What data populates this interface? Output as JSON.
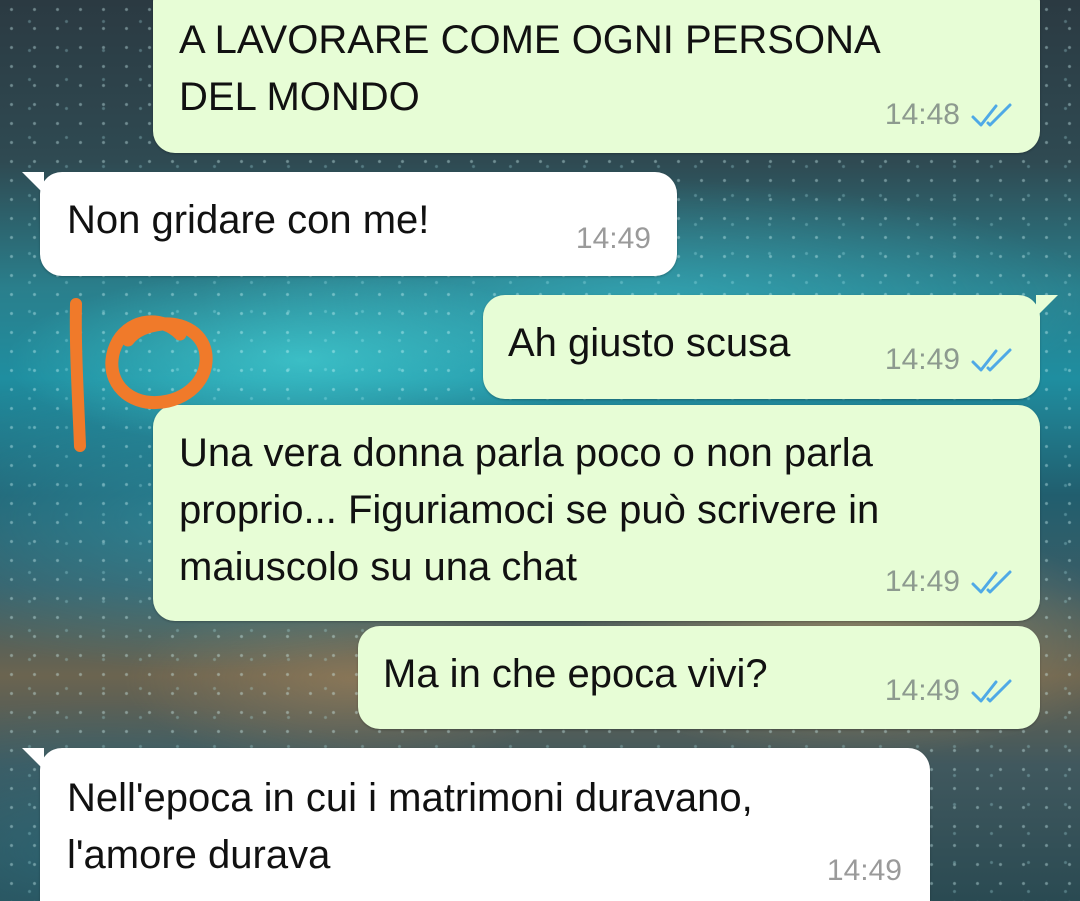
{
  "messages": [
    {
      "direction": "outgoing",
      "text": "A LAVORARE COME OGNI PERSONA\nDEL MONDO",
      "time": "14:48",
      "status_icon": "double-check-read-icon"
    },
    {
      "direction": "incoming",
      "text": "Non gridare con me!",
      "time": "14:49"
    },
    {
      "direction": "outgoing",
      "text": "Ah giusto scusa",
      "time": "14:49",
      "status_icon": "double-check-read-icon"
    },
    {
      "direction": "outgoing",
      "text": "Una vera donna parla poco o non parla\nproprio... Figuriamoci se può scrivere in\nmaiuscolo su una chat",
      "time": "14:49",
      "status_icon": "double-check-read-icon"
    },
    {
      "direction": "outgoing",
      "text": "Ma in che epoca vivi?",
      "time": "14:49",
      "status_icon": "double-check-read-icon"
    },
    {
      "direction": "incoming",
      "text": "Nell'epoca in cui i matrimoni duravano,\nl'amore durava",
      "time": "14:49"
    }
  ],
  "annotation": {
    "text": "10",
    "color": "#f07a2a"
  },
  "colors": {
    "outgoing_bubble": "#e7fdd6",
    "incoming_bubble": "#ffffff",
    "read_ticks": "#4fa9e6",
    "timestamp": "#8d9a8f"
  }
}
